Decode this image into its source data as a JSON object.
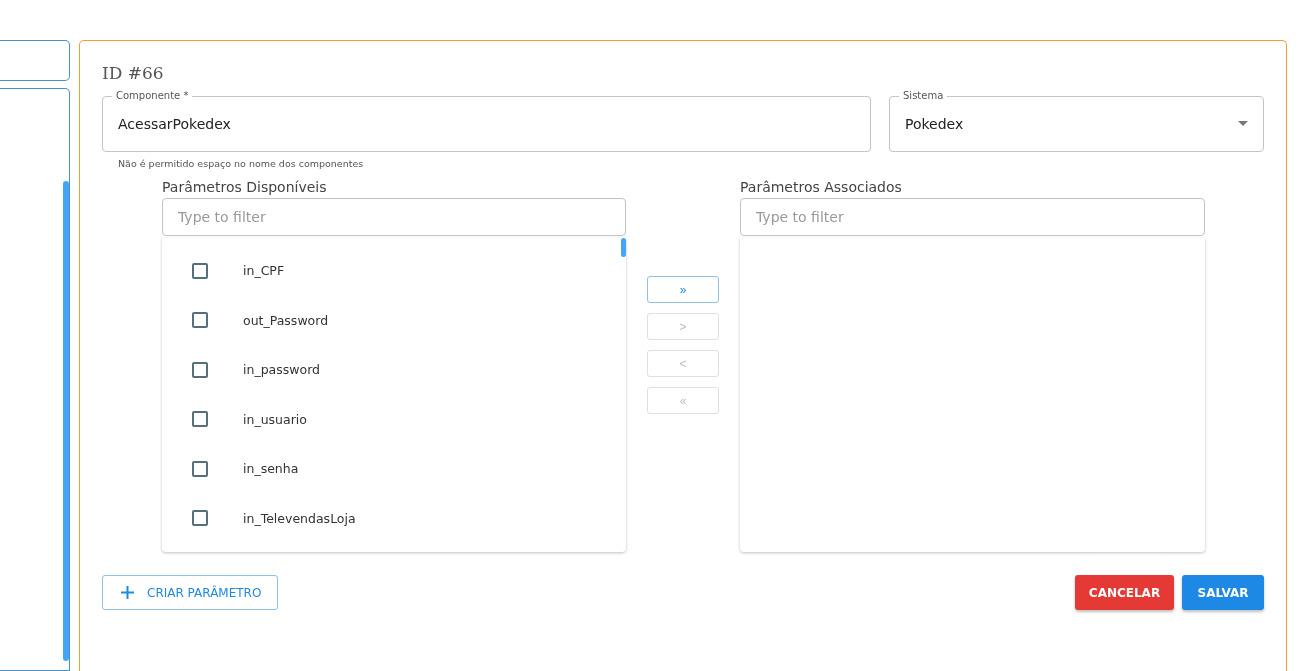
{
  "form": {
    "title": "ID #66",
    "component_field": {
      "label": "Componente *",
      "value": "AcessarPokedex",
      "helper": "Não é permitido espaço no nome dos componentes"
    },
    "system_field": {
      "label": "Sistema",
      "value": "Pokedex"
    }
  },
  "available": {
    "label": "Parâmetros Disponíveis",
    "filter": {
      "placeholder": "Type to filter"
    },
    "items": [
      {
        "label": "in_CPF",
        "checked": false
      },
      {
        "label": "out_Password",
        "checked": false
      },
      {
        "label": "in_password",
        "checked": false
      },
      {
        "label": "in_usuario",
        "checked": false
      },
      {
        "label": "in_senha",
        "checked": false
      },
      {
        "label": "in_TelevendasLoja",
        "checked": false
      }
    ]
  },
  "transfer_buttons": [
    {
      "label": "»",
      "disabled": false
    },
    {
      "label": ">",
      "disabled": true
    },
    {
      "label": "<",
      "disabled": true
    },
    {
      "label": "«",
      "disabled": true
    }
  ],
  "associated": {
    "label": "Parâmetros Associados",
    "filter": {
      "placeholder": "Type to filter"
    }
  },
  "actions": {
    "create": "CRIAR PARÂMETRO",
    "cancel": "CANCELAR",
    "save": "SALVAR"
  }
}
